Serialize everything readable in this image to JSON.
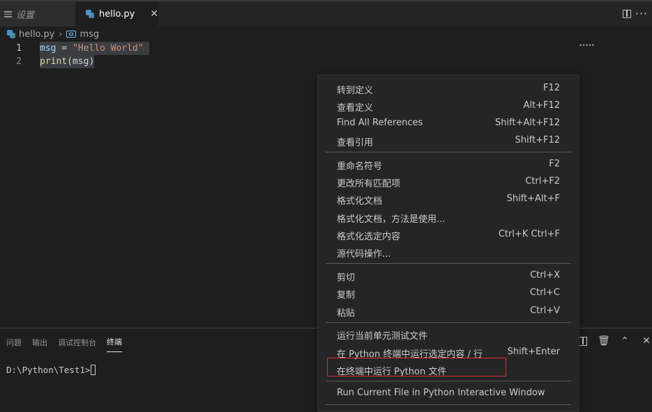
{
  "tabs": [
    {
      "label": "设置",
      "active": false
    },
    {
      "label": "hello.py",
      "active": true
    }
  ],
  "breadcrumb": {
    "file": "hello.py",
    "symbol": "msg"
  },
  "editor": {
    "lines": [
      {
        "number": "1",
        "parts": [
          "msg",
          " = ",
          "\"Hello World\""
        ]
      },
      {
        "number": "2",
        "parts": [
          "print",
          "(msg)"
        ]
      }
    ],
    "minimap_text": "▪▪▪▪▪"
  },
  "panel": {
    "tabs": [
      "问题",
      "输出",
      "调试控制台",
      "终端"
    ],
    "active_tab": "终端",
    "terminal_prompt": "D:\\Python\\Test1>"
  },
  "context_menu": {
    "items": [
      {
        "label": "转到定义",
        "key": "F12"
      },
      {
        "label": "查看定义",
        "key": "Alt+F12"
      },
      {
        "label": "Find All References",
        "key": "Shift+Alt+F12"
      },
      {
        "label": "查看引用",
        "key": "Shift+F12"
      },
      {
        "label": "重命名符号",
        "key": "F2"
      },
      {
        "label": "更改所有匹配项",
        "key": "Ctrl+F2"
      },
      {
        "label": "格式化文档",
        "key": "Shift+Alt+F"
      },
      {
        "label": "格式化文档，方法是使用...",
        "key": ""
      },
      {
        "label": "格式化选定内容",
        "key": "Ctrl+K Ctrl+F"
      },
      {
        "label": "源代码操作...",
        "key": ""
      },
      {
        "label": "剪切",
        "key": "Ctrl+X"
      },
      {
        "label": "复制",
        "key": "Ctrl+C"
      },
      {
        "label": "粘贴",
        "key": "Ctrl+V"
      },
      {
        "label": "运行当前单元测试文件",
        "key": ""
      },
      {
        "label": "在 Python 终端中运行选定内容 / 行",
        "key": "Shift+Enter"
      },
      {
        "label": "在终端中运行 Python 文件",
        "key": "",
        "highlighted": true
      },
      {
        "label": "Run Current File in Python Interactive Window",
        "key": ""
      }
    ]
  },
  "colors": {
    "highlight_border": "#e03030",
    "string": "#ce9178",
    "variable": "#9cdcfe",
    "function": "#dcdcaa"
  }
}
